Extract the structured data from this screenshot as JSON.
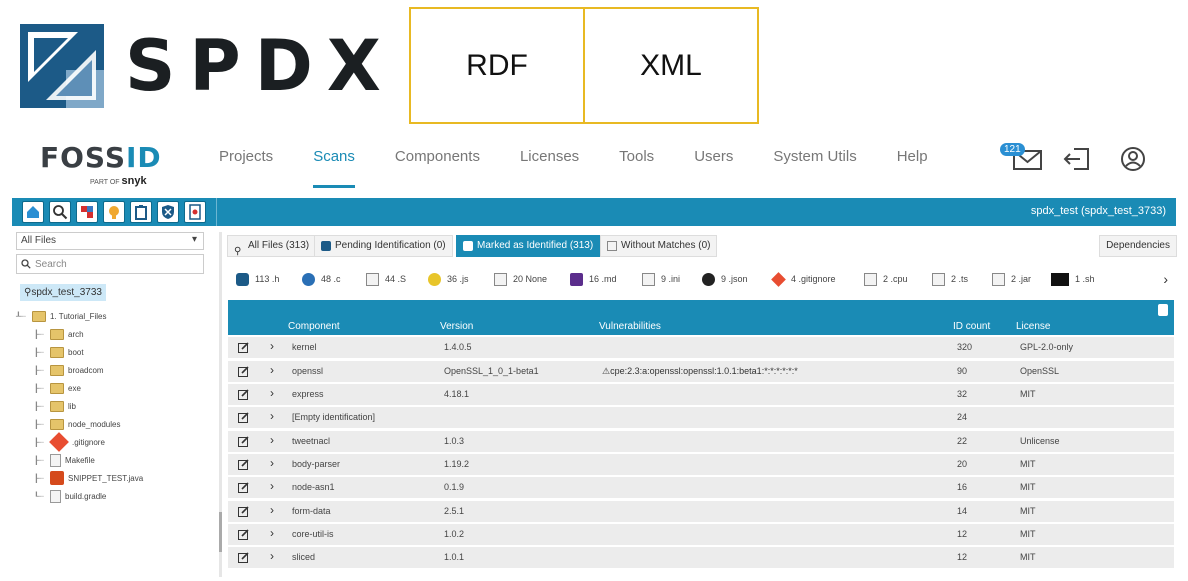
{
  "banner": {
    "logo_text": "SPDX",
    "formats": [
      "RDF",
      "XML"
    ],
    "colors": {
      "box_border": "#e8b923",
      "logo_blue": "#1c5a87"
    }
  },
  "nav": {
    "brand": {
      "name_a": "FOSS",
      "name_b": "ID",
      "tagline_a": "PART OF",
      "tagline_b": "snyk"
    },
    "items": [
      {
        "label": "Projects",
        "active": false
      },
      {
        "label": "Scans",
        "active": true
      },
      {
        "label": "Components",
        "active": false
      },
      {
        "label": "Licenses",
        "active": false
      },
      {
        "label": "Tools",
        "active": false
      },
      {
        "label": "Users",
        "active": false
      },
      {
        "label": "System Utils",
        "active": false
      },
      {
        "label": "Help",
        "active": false
      }
    ],
    "mail_count": "121",
    "icons": [
      "mail-icon",
      "logout-icon",
      "user-icon"
    ],
    "accent": "#1a8bb5"
  },
  "toolbar": {
    "icons": [
      "home-icon",
      "search-icon",
      "report-icon",
      "license-icon",
      "clipboard-icon",
      "shield-icon",
      "settings-doc-icon"
    ],
    "project": "spdx_test (spdx_test_3733)"
  },
  "left": {
    "filter_value": "All Files",
    "search_placeholder": "Search",
    "root": "spdx_test_3733",
    "tree": [
      {
        "label": "1. Tutorial_Files",
        "kind": "folder",
        "depth": 0
      },
      {
        "label": "arch",
        "kind": "folder",
        "depth": 1
      },
      {
        "label": "boot",
        "kind": "folder",
        "depth": 1
      },
      {
        "label": "broadcom",
        "kind": "folder",
        "depth": 1
      },
      {
        "label": "exe",
        "kind": "folder",
        "depth": 1
      },
      {
        "label": "lib",
        "kind": "folder",
        "depth": 1
      },
      {
        "label": "node_modules",
        "kind": "folder",
        "depth": 1
      },
      {
        "label": ".gitignore",
        "kind": "git",
        "depth": 1
      },
      {
        "label": "Makefile",
        "kind": "file",
        "depth": 1
      },
      {
        "label": "SNIPPET_TEST.java",
        "kind": "java",
        "depth": 1
      },
      {
        "label": "build.gradle",
        "kind": "file",
        "depth": 1
      }
    ]
  },
  "tabs": [
    {
      "label": "All Files (313)",
      "active": false
    },
    {
      "label": "Pending Identification (0)",
      "active": false
    },
    {
      "label": "Marked as Identified (313)",
      "active": true
    },
    {
      "label": "Without Matches (0)",
      "active": false
    }
  ],
  "dependencies_label": "Dependencies",
  "extensions": [
    {
      "count": "113",
      "ext": ".h",
      "icon": "hex-icon",
      "color": "#1c5a87"
    },
    {
      "count": "48",
      "ext": ".c",
      "icon": "c-icon",
      "color": "#2a6fb5"
    },
    {
      "count": "44",
      "ext": ".S",
      "icon": "doc-icon",
      "color": "#888888"
    },
    {
      "count": "36",
      "ext": ".js",
      "icon": "js-icon",
      "color": "#e8c52a"
    },
    {
      "count": "20",
      "ext": "None",
      "icon": "doc-icon",
      "color": "#888888"
    },
    {
      "count": "16",
      "ext": ".md",
      "icon": "markdown-icon",
      "color": "#5b2d8c"
    },
    {
      "count": "9",
      "ext": ".ini",
      "icon": "doc-icon",
      "color": "#888888"
    },
    {
      "count": "9",
      "ext": ".json",
      "icon": "json-icon",
      "color": "#222222"
    },
    {
      "count": "4",
      "ext": ".gitignore",
      "icon": "git-icon",
      "color": "#e84d31"
    },
    {
      "count": "2",
      "ext": ".cpu",
      "icon": "doc-icon",
      "color": "#888888"
    },
    {
      "count": "2",
      "ext": ".ts",
      "icon": "doc-icon",
      "color": "#888888"
    },
    {
      "count": "2",
      "ext": ".jar",
      "icon": "doc-icon",
      "color": "#888888"
    },
    {
      "count": "1",
      "ext": ".sh",
      "icon": "terminal-icon",
      "color": "#111111"
    }
  ],
  "table": {
    "headers": [
      "Component",
      "Version",
      "Vulnerabilities",
      "ID count",
      "License"
    ],
    "rows": [
      {
        "component": "kernel",
        "version": "1.4.0.5",
        "vuln": "",
        "id_count": "320",
        "license": "GPL-2.0-only"
      },
      {
        "component": "openssl",
        "version": "OpenSSL_1_0_1-beta1",
        "vuln": "cpe:2.3:a:openssl:openssl:1.0.1:beta1:*:*:*:*:*:*",
        "id_count": "90",
        "license": "OpenSSL"
      },
      {
        "component": "express",
        "version": "4.18.1",
        "vuln": "",
        "id_count": "32",
        "license": "MIT"
      },
      {
        "component": "[Empty identification]",
        "version": "",
        "vuln": "",
        "id_count": "24",
        "license": ""
      },
      {
        "component": "tweetnacl",
        "version": "1.0.3",
        "vuln": "",
        "id_count": "22",
        "license": "Unlicense"
      },
      {
        "component": "body-parser",
        "version": "1.19.2",
        "vuln": "",
        "id_count": "20",
        "license": "MIT"
      },
      {
        "component": "node-asn1",
        "version": "0.1.9",
        "vuln": "",
        "id_count": "16",
        "license": "MIT"
      },
      {
        "component": "form-data",
        "version": "2.5.1",
        "vuln": "",
        "id_count": "14",
        "license": "MIT"
      },
      {
        "component": "core-util-is",
        "version": "1.0.2",
        "vuln": "",
        "id_count": "12",
        "license": "MIT"
      },
      {
        "component": "sliced",
        "version": "1.0.1",
        "vuln": "",
        "id_count": "12",
        "license": "MIT"
      }
    ]
  }
}
